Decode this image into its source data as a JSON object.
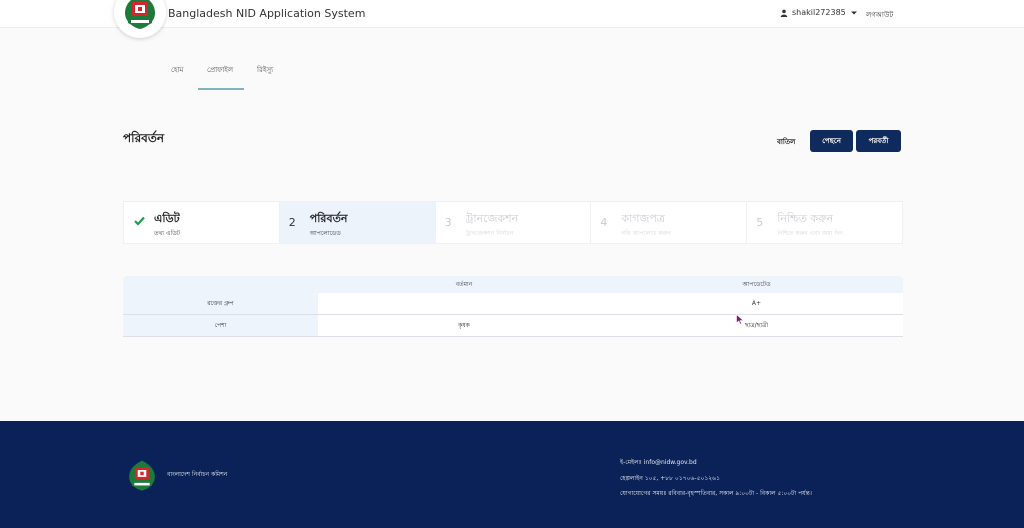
{
  "header": {
    "app_title": "Bangladesh NID Application System",
    "username": "shakil272385",
    "logout_label": "লগআউট"
  },
  "nav": {
    "tabs": [
      {
        "label": "হোম"
      },
      {
        "label": "প্রোফাইল",
        "active": true
      },
      {
        "label": "রিইস্যু"
      }
    ]
  },
  "page": {
    "title": "পরিবর্তন",
    "cancel_label": "বাতিল",
    "back_label": "পেছনে",
    "next_label": "পরবর্তী"
  },
  "stepper": {
    "steps": [
      {
        "number": "",
        "title": "এডিট",
        "subtitle": "তথ্য এডিট",
        "status": "completed"
      },
      {
        "number": "2",
        "title": "পরিবর্তন",
        "subtitle": "আপলোডেড",
        "status": "active"
      },
      {
        "number": "3",
        "title": "ট্রানজেকশন",
        "subtitle": "ট্রানজেকশন নির্বাচন",
        "status": "disabled"
      },
      {
        "number": "4",
        "title": "কাগজপত্র",
        "subtitle": "নথি আপলোড করুন",
        "status": "disabled"
      },
      {
        "number": "5",
        "title": "নিশ্চিত করুন",
        "subtitle": "নিশ্চিত করুন এবং জমা দিন",
        "status": "disabled"
      }
    ]
  },
  "table": {
    "headers": [
      "",
      "বর্তমান",
      "আপডেটেড"
    ],
    "rows": [
      {
        "label": "রক্তের গ্রুপ",
        "current": "",
        "updated": "A+"
      },
      {
        "label": "পেশা",
        "current": "কৃষক",
        "updated": "ছাত্র/ছাত্রী"
      }
    ]
  },
  "footer": {
    "org_name": "বাংলাদেশ নির্বাচন কমিশন",
    "email": "ই-মেইলঃ info@nidw.gov.bd",
    "hotline": "হেল্পলাইন ১০৫, +৮৮ ০১৭০৬-৫০১২৬১",
    "hours": "যোগাযোগের সময়ঃ রবিবার-বৃহস্পতিবার, সকাল ৯:০০টা - বিকাল ৫:০০টা পর্যন্ত।"
  },
  "colors": {
    "primary_navy": "#0f2a5c",
    "footer_bg": "#0a2257",
    "active_step_bg": "#ecf3fb",
    "check_green": "#1e9e4a"
  }
}
